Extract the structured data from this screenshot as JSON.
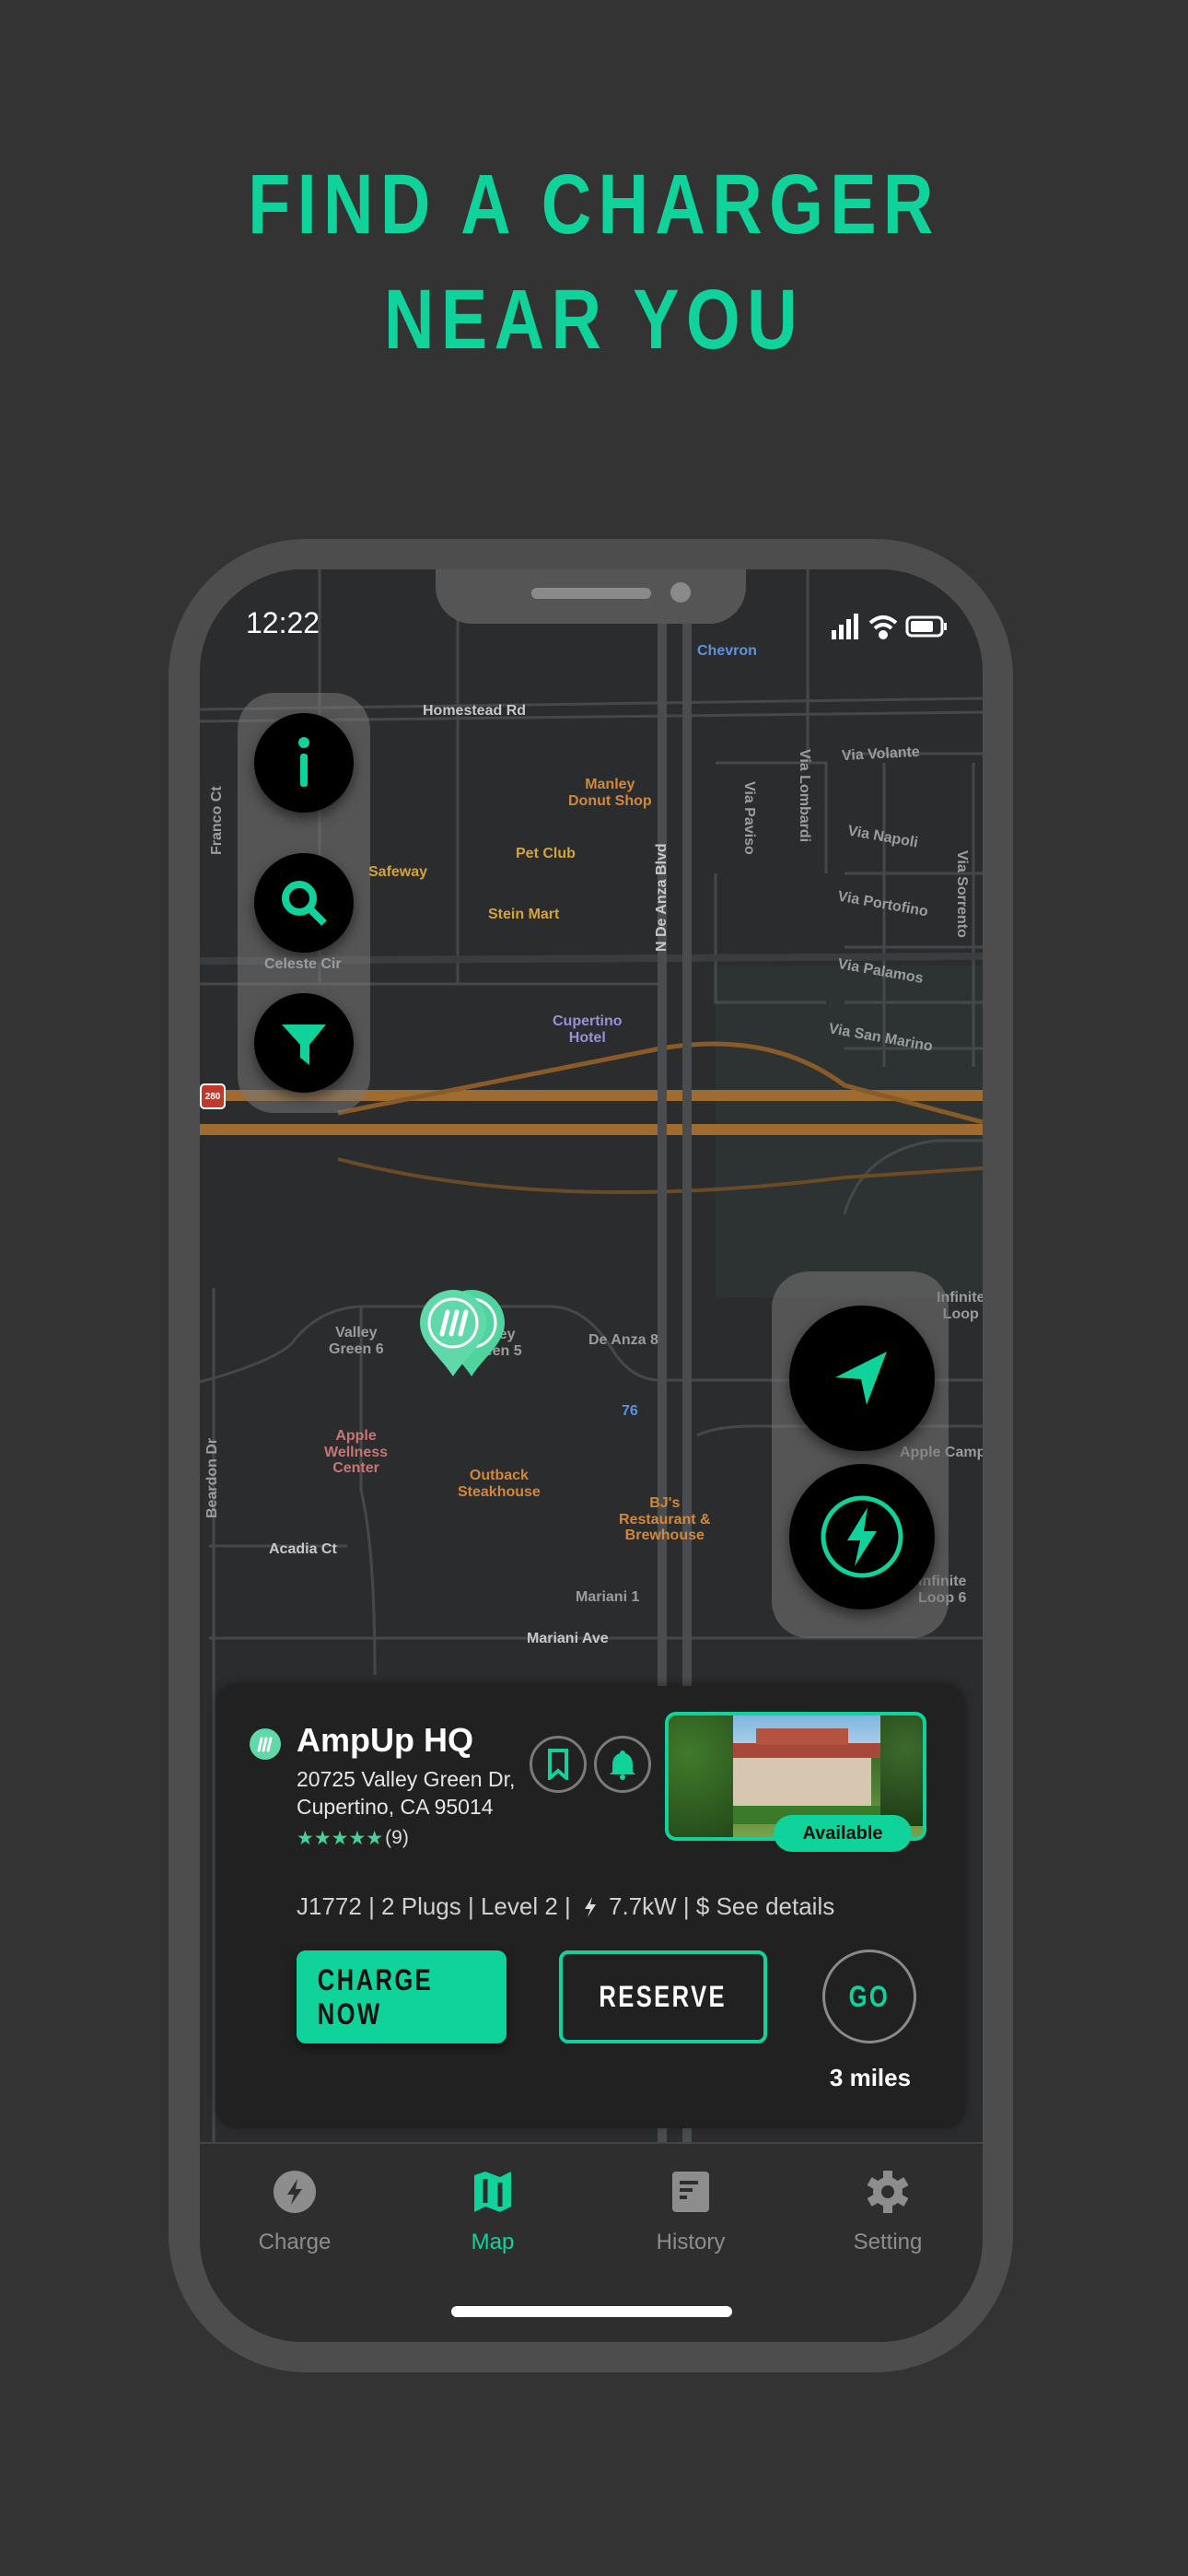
{
  "headline": {
    "line1": "FIND A CHARGER",
    "line2": "NEAR YOU"
  },
  "colors": {
    "accent": "#0fd39b",
    "background": "#333333",
    "card": "#212121"
  },
  "status_bar": {
    "time": "12:22",
    "icons": [
      "signal-icon",
      "wifi-icon",
      "battery-icon"
    ]
  },
  "map": {
    "labels": {
      "chevron": "Chevron",
      "homestead": "Homestead Rd",
      "manley": "Manley\nDonut Shop",
      "pet_club": "Pet Club",
      "stein_mart": "Stein Mart",
      "safeway": "Safeway",
      "cupertino_hotel": "Cupertino\nHotel",
      "de_anza_blvd": "N De Anza Blvd",
      "via_volante": "Via Volante",
      "via_lombardi": "Via Lombardi",
      "via_paviso": "Via Paviso",
      "via_napoli": "Via Napoli",
      "via_portofino": "Via Portofino",
      "via_palamos": "Via Palamos",
      "via_san_marino": "Via San Marino",
      "via_sorrento": "Via Sorrento",
      "franco_ct": "Franco Ct",
      "celeste_cir": "Celeste Cir",
      "valley_green_6": "Valley\nGreen 6",
      "valley_green_5": "Valley\nGreen 5",
      "de_anza_8": "De Anza 8",
      "gas_76": "76",
      "apple_wellness": "Apple\nWellness\nCenter",
      "outback": "Outback\nSteakhouse",
      "bjs": "BJ's\nRestaurant &\nBrewhouse",
      "acadia_ct": "Acadia Ct",
      "mariani_1": "Mariani 1",
      "mariani_ave": "Mariani Ave",
      "beardon_dr": "Beardon Dr",
      "apple_campus": "Apple Camp",
      "infinite_loop_6": "Infinite\nLoop 6",
      "infinite_loop": "Infinite\nLoop",
      "interstate": "280"
    },
    "left_controls": [
      "info-icon",
      "search-icon",
      "filter-icon"
    ],
    "right_controls": [
      "locate-arrow-icon",
      "charge-bolt-icon"
    ]
  },
  "station": {
    "name": "AmpUp HQ",
    "address_line1": "20725 Valley Green Dr,",
    "address_line2": "Cupertino, CA 95014",
    "rating": 5,
    "stars": "★★★★★",
    "review_count": "(9)",
    "status": "Available",
    "specs": "J1772 | 2 Plugs | Level 2 | ",
    "power": "7.7kW | $ See details",
    "charge_now": "CHARGE NOW",
    "reserve": "RESERVE",
    "go": "GO",
    "distance": "3 miles"
  },
  "tabs": [
    {
      "label": "Charge",
      "icon": "bolt-circle-icon",
      "active": false
    },
    {
      "label": "Map",
      "icon": "map-icon",
      "active": true
    },
    {
      "label": "History",
      "icon": "document-icon",
      "active": false
    },
    {
      "label": "Setting",
      "icon": "gear-icon",
      "active": false
    }
  ]
}
